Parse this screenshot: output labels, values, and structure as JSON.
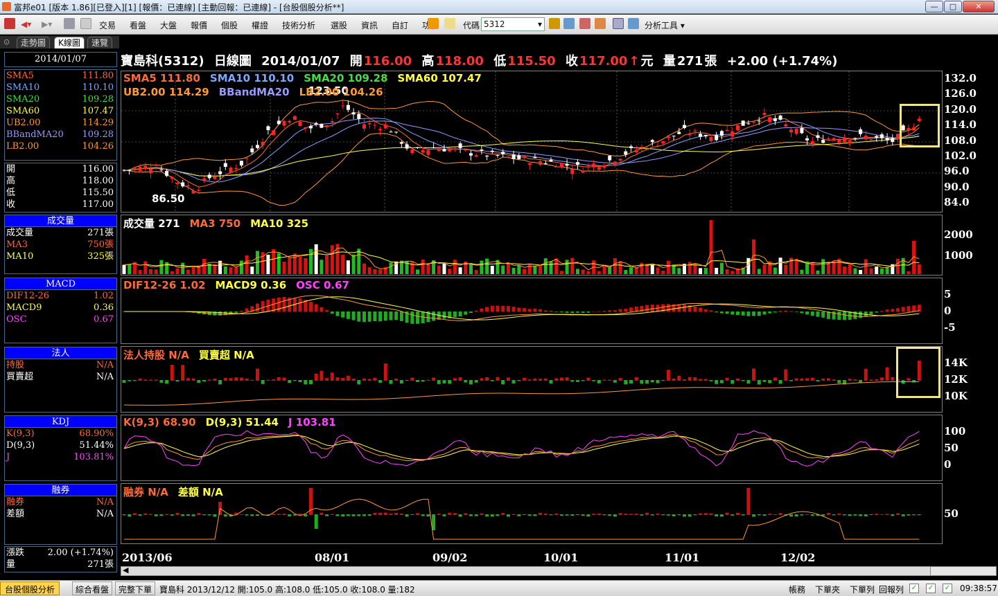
{
  "window": {
    "title": "富邦e01 [版本 1.86][已登入][1] [報價：已連線] [主動回報：已連線] - [台股個股分析**]",
    "min": "—",
    "max": "□",
    "close": "✕"
  },
  "toolbar": {
    "menus": [
      "交易",
      "看盤",
      "大盤",
      "報價",
      "個股",
      "權證",
      "技術分析",
      "選股",
      "資訊",
      "自訂",
      "功能"
    ],
    "code_label": "代碼",
    "code_value": "5312",
    "tools_label": "分析工具"
  },
  "tabs": [
    "走勢圖",
    "K線圖",
    "速覽"
  ],
  "left": {
    "date": "2014/01/07",
    "ma": [
      {
        "k": "SMA5",
        "v": "111.80",
        "c": "#ff6a3a"
      },
      {
        "k": "SMA10",
        "v": "110.10",
        "c": "#7aa8ff"
      },
      {
        "k": "SMA20",
        "v": "109.28",
        "c": "#44dd44"
      },
      {
        "k": "SMA60",
        "v": "107.47",
        "c": "#ffff44"
      },
      {
        "k": "UB2.00",
        "v": "114.29",
        "c": "#ff9933"
      },
      {
        "k": "BBandMA20",
        "v": "109.28",
        "c": "#9999ff"
      },
      {
        "k": "LB2.00",
        "v": "104.26",
        "c": "#ff9933"
      }
    ],
    "ohlc": [
      {
        "k": "開",
        "v": "116.00"
      },
      {
        "k": "高",
        "v": "118.00"
      },
      {
        "k": "低",
        "v": "115.50"
      },
      {
        "k": "收",
        "v": "117.00"
      }
    ],
    "vol_head": "成交量",
    "vol": [
      {
        "k": "成交量",
        "v": "271張",
        "c": "#ffffff"
      },
      {
        "k": "MA3",
        "v": "750張",
        "c": "#ff6a3a"
      },
      {
        "k": "MA10",
        "v": "325張",
        "c": "#ffff44"
      }
    ],
    "macd_head": "MACD",
    "macd": [
      {
        "k": "DIF12-26",
        "v": "1.02",
        "c": "#ff6a3a"
      },
      {
        "k": "MACD9",
        "v": "0.36",
        "c": "#ffff44"
      },
      {
        "k": "OSC",
        "v": "0.67",
        "c": "#ff44ff"
      }
    ],
    "inst_head": "法人",
    "inst": [
      {
        "k": "持股",
        "v": "N/A",
        "c": "#ff6a3a"
      },
      {
        "k": "買賣超",
        "v": "N/A",
        "c": "#ffffff"
      }
    ],
    "kdj_head": "KDJ",
    "kdj": [
      {
        "k": "K(9,3)",
        "v": "68.90%",
        "c": "#ff6a3a"
      },
      {
        "k": "D(9,3)",
        "v": "51.44%",
        "c": "#ffffff"
      },
      {
        "k": "J",
        "v": "103.81%",
        "c": "#ff44ff"
      }
    ],
    "short_head": "融券",
    "short": [
      {
        "k": "融券",
        "v": "N/A",
        "c": "#ff6a3a"
      },
      {
        "k": "差額",
        "v": "N/A",
        "c": "#ffffff"
      }
    ],
    "chg": {
      "k": "漲跌",
      "v": "2.00 (+1.74%)"
    },
    "qty": {
      "k": "量",
      "v": "271張"
    }
  },
  "header": {
    "name": "寶島科(5312)",
    "period": "日線圖",
    "date": "2014/01/07",
    "open_l": "開",
    "open": "116.00",
    "high_l": "高",
    "high": "118.00",
    "low_l": "低",
    "low": "115.50",
    "close_l": "收",
    "close": "117.00",
    "unit": "元",
    "vol_l": "量",
    "vol": "271",
    "vol_u": "張",
    "chg": "+2.00 (+1.74%)"
  },
  "legends": {
    "price1": [
      {
        "t": "SMA5 111.80",
        "c": "#ff6a3a"
      },
      {
        "t": "SMA10 110.10",
        "c": "#7aa8ff"
      },
      {
        "t": "SMA20 109.28",
        "c": "#44dd44"
      },
      {
        "t": "SMA60 107.47",
        "c": "#ffff44"
      }
    ],
    "price2": [
      {
        "t": "UB2.00 114.29",
        "c": "#ff9933"
      },
      {
        "t": "BBandMA20",
        "c": "#9999ff"
      },
      {
        "t": "LB2.00 104.26",
        "c": "#ff9933"
      }
    ],
    "vol": [
      {
        "t": "成交量 271",
        "c": "#ffffff"
      },
      {
        "t": "MA3 750",
        "c": "#ff6a3a"
      },
      {
        "t": "MA10 325",
        "c": "#ffff44"
      }
    ],
    "macd": [
      {
        "t": "DIF12-26 1.02",
        "c": "#ff6a3a"
      },
      {
        "t": "MACD9 0.36",
        "c": "#ffff44"
      },
      {
        "t": "OSC 0.67",
        "c": "#ff44ff"
      }
    ],
    "inst": [
      {
        "t": "法人持股 N/A",
        "c": "#ff6a3a"
      },
      {
        "t": "買賣超 N/A",
        "c": "#ffff44"
      }
    ],
    "kdj": [
      {
        "t": "K(9,3) 68.90",
        "c": "#ff6a3a"
      },
      {
        "t": "D(9,3) 51.44",
        "c": "#ffff44"
      },
      {
        "t": "J 103.81",
        "c": "#ff44ff"
      }
    ],
    "short": [
      {
        "t": "融券 N/A",
        "c": "#ff6a3a"
      },
      {
        "t": "差額 N/A",
        "c": "#ffff44"
      }
    ]
  },
  "annotations": {
    "high": "123.50",
    "low": "86.50"
  },
  "axes": {
    "price": [
      "132.0",
      "126.0",
      "120.0",
      "114.0",
      "108.0",
      "102.0",
      "96.0",
      "90.0",
      "84.0"
    ],
    "vol": [
      "2000",
      "1000"
    ],
    "macd": [
      "5",
      "0",
      "-5"
    ],
    "inst": [
      "14K",
      "12K",
      "10K"
    ],
    "kdj": [
      "100",
      "50",
      "0"
    ],
    "short": [
      "50"
    ],
    "dates": [
      "2013/06",
      "08/01",
      "09/02",
      "10/01",
      "11/01",
      "12/02"
    ]
  },
  "status": {
    "tab1": "台股個股分析",
    "tab2": "綜合看盤",
    "tab3": "完整下單",
    "ticker": "寶島科 2013/12/12 開:105.0 高:108.0 低:105.0 收:108.0 量:182",
    "b1": "帳務",
    "b2": "下單夾",
    "b3": "下單列",
    "b4": "回報列",
    "time": "09:38:57"
  },
  "chart_data": {
    "type": "candlestick",
    "stock": "寶島科(5312)",
    "period": "日線圖",
    "last": {
      "date": "2014/01/07",
      "open": 116.0,
      "high": 118.0,
      "low": 115.5,
      "close": 117.0,
      "volume": 271
    },
    "price_ylim": [
      84,
      132
    ],
    "period_high": 123.5,
    "period_low": 86.5
  }
}
